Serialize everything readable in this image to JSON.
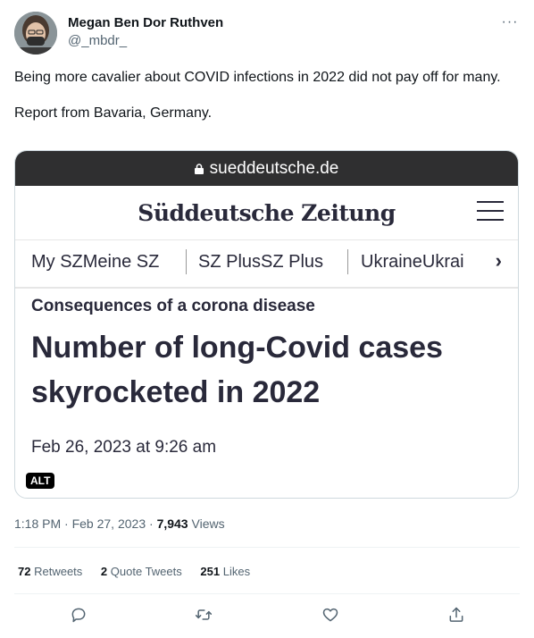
{
  "author": {
    "name": "Megan Ben Dor Ruthven",
    "handle": "@_mbdr_"
  },
  "more_label": "···",
  "tweet": {
    "text_1": "Being more cavalier about COVID infections in 2022 did not pay off for many.",
    "text_2": "Report from Bavaria, Germany."
  },
  "media": {
    "url": "sueddeutsche.de",
    "logo": "Süddeutsche Zeitung",
    "nav": [
      "My SZMeine SZ",
      "SZ PlusSZ Plus",
      "UkraineUkrai"
    ],
    "nav_arrow": "›",
    "kicker": "Consequences of a corona disease",
    "headline": "Number of long-Covid cases skyrocketed in 2022",
    "date": "Feb 26, 2023 at 9:26 am",
    "alt_badge": "ALT"
  },
  "meta": {
    "time": "1:18 PM",
    "sep1": "·",
    "date": "Feb 27, 2023",
    "sep2": "·",
    "views_count": "7,943",
    "views_label": "Views"
  },
  "stats": {
    "retweets_count": "72",
    "retweets_label": "Retweets",
    "quotes_count": "2",
    "quotes_label": "Quote Tweets",
    "likes_count": "251",
    "likes_label": "Likes"
  },
  "colors": {
    "text": "#0f1419",
    "secondary": "#536471",
    "border": "#cfd9de",
    "sz_text": "#29293a",
    "urlbar": "#2f2f30"
  },
  "icons": [
    "reply-icon",
    "retweet-icon",
    "like-icon",
    "share-icon"
  ]
}
